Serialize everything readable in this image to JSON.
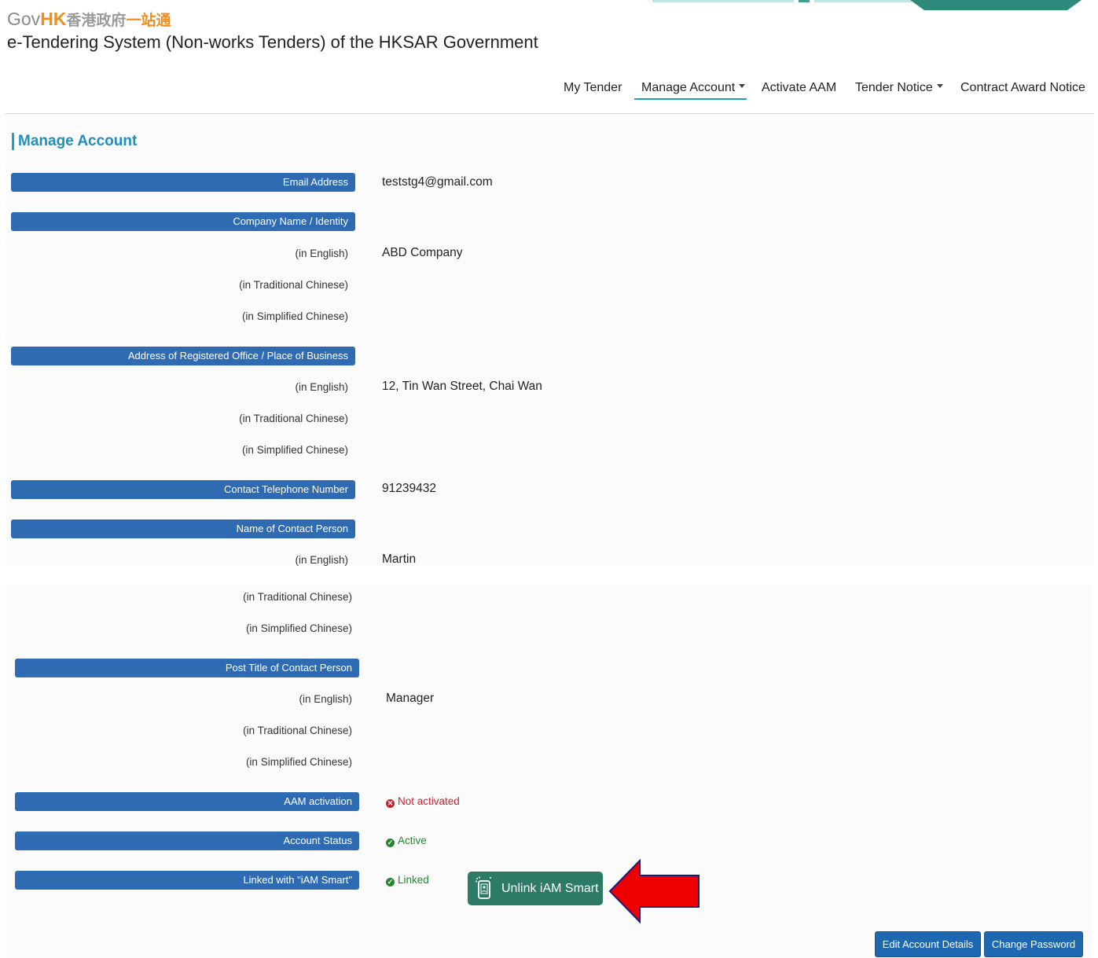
{
  "header": {
    "logo_gov": "Gov",
    "logo_hk": "HK",
    "logo_zh1": "香港政府",
    "logo_zh2": "一站通",
    "system_title": "e-Tendering System (Non-works Tenders) of the HKSAR Government"
  },
  "nav": {
    "items": [
      {
        "label": "My Tender"
      },
      {
        "label": "Manage Account"
      },
      {
        "label": "Activate AAM"
      },
      {
        "label": "Tender Notice"
      },
      {
        "label": "Contract Award Notice"
      }
    ],
    "active": "Manage Account"
  },
  "page": {
    "title": "Manage Account"
  },
  "sub_labels": {
    "english": "(in English)",
    "traditional": "(in Traditional Chinese)",
    "simplified": "(in Simplified Chinese)"
  },
  "fields": {
    "email": {
      "label": "Email Address",
      "value": "teststg4@gmail.com"
    },
    "company": {
      "label": "Company Name / Identity",
      "en": "ABD Company",
      "tc": "",
      "sc": ""
    },
    "address": {
      "label": "Address of Registered Office / Place of Business",
      "en": "12, Tin Wan Street, Chai Wan",
      "tc": "",
      "sc": ""
    },
    "telephone": {
      "label": "Contact Telephone Number",
      "value": "91239432"
    },
    "contact_person": {
      "label": "Name of Contact Person",
      "en": "Martin",
      "tc": "",
      "sc": ""
    },
    "post_title": {
      "label": "Post Title of Contact Person",
      "en": "Manager",
      "tc": "",
      "sc": ""
    },
    "aam": {
      "label": "AAM activation",
      "status": "Not activated"
    },
    "account_status": {
      "label": "Account Status",
      "status": "Active"
    },
    "iam_smart": {
      "label": "Linked with \"iAM Smart\"",
      "status": "Linked"
    }
  },
  "buttons": {
    "unlink_iam": "Unlink iAM Smart",
    "edit_account": "Edit Account Details",
    "change_password": "Change Password"
  },
  "colors": {
    "label_bar": "#2e6bb3",
    "accent": "#1aa3c9",
    "iam_green": "#2d7a66",
    "status_red": "#d0202e",
    "status_green": "#1f8a2c",
    "arrow_red": "#ee0000"
  },
  "icons": {
    "not_activated": "x-circle-icon",
    "active": "check-circle-icon",
    "linked": "check-circle-icon",
    "iam_smart": "iam-smart-icon",
    "callout": "red-arrow-pointer"
  }
}
